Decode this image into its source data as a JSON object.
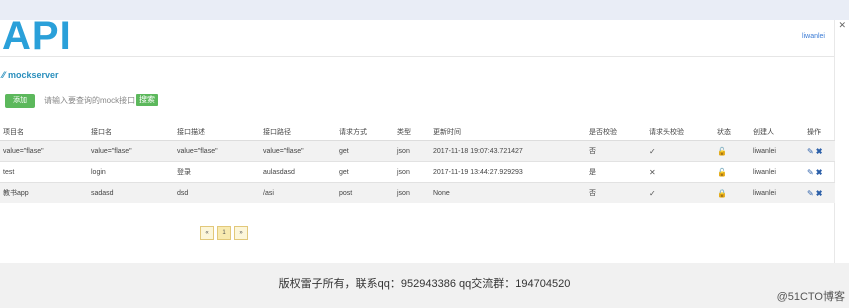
{
  "header": {
    "logo": "API",
    "user_link": "liwanlei"
  },
  "breadcrumb": {
    "separator": "⁄⁄",
    "title": "mockserver"
  },
  "toolbar": {
    "add_label": "添加",
    "search_placeholder": "请输入要查询的mock接口",
    "search_label": "搜索"
  },
  "table": {
    "columns": [
      "项目名",
      "接口名",
      "接口描述",
      "接口路径",
      "请求方式",
      "类型",
      "更新时间",
      "是否校验",
      "请求头校验",
      "状态",
      "创建人",
      "操作"
    ],
    "rows": [
      {
        "project": "value=\"flase\"",
        "name": "value=\"flase\"",
        "desc": "value=\"flase\"",
        "path": "value=\"flase\"",
        "method": "get",
        "type": "json",
        "updated": "2017-11-18 19:07:43.721427",
        "check": "否",
        "header_check": "✓",
        "status_icon": "unlock-icon",
        "creator": "liwanlei"
      },
      {
        "project": "test",
        "name": "login",
        "desc": "登录",
        "path": "aulasdasd",
        "method": "get",
        "type": "json",
        "updated": "2017-11-19 13:44:27.929293",
        "check": "是",
        "header_check": "✕",
        "status_icon": "unlock-icon",
        "creator": "liwanlei"
      },
      {
        "project": "教书app",
        "name": "sadasd",
        "desc": "dsd",
        "path": "/asi",
        "method": "post",
        "type": "json",
        "updated": "None",
        "check": "否",
        "header_check": "✓",
        "status_icon": "lock-icon",
        "creator": "liwanlei"
      }
    ]
  },
  "pagination": {
    "prev": "«",
    "current": "1",
    "next": "»"
  },
  "footer": {
    "text": "版权雷子所有，联系qq：952943386 qq交流群：194704520"
  },
  "watermark": "@51CTO博客"
}
